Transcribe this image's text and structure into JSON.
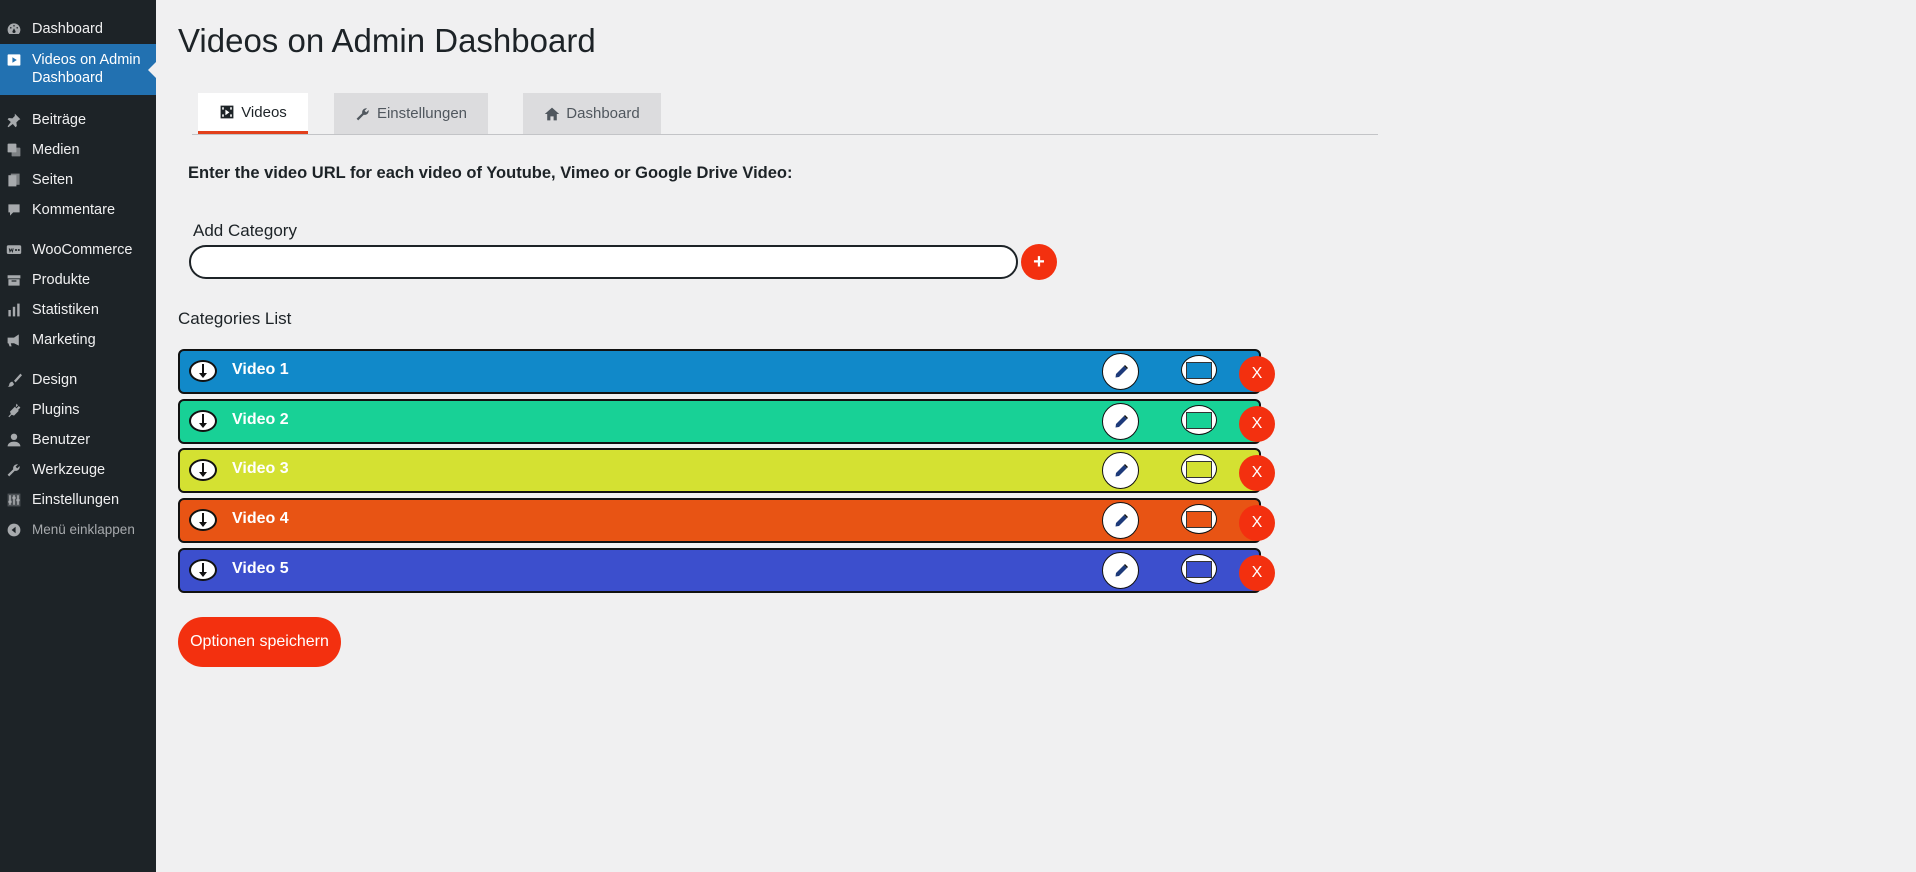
{
  "sidebar": {
    "items": [
      {
        "label": "Dashboard",
        "icon": "dashboard-icon"
      },
      {
        "label": "Videos on Admin Dashboard",
        "icon": "video-icon",
        "active": true
      },
      {
        "label": "Beiträge",
        "icon": "pin-icon"
      },
      {
        "label": "Medien",
        "icon": "media-icon"
      },
      {
        "label": "Seiten",
        "icon": "pages-icon"
      },
      {
        "label": "Kommentare",
        "icon": "comment-icon"
      },
      {
        "label": "WooCommerce",
        "icon": "woocommerce-icon"
      },
      {
        "label": "Produkte",
        "icon": "products-icon"
      },
      {
        "label": "Statistiken",
        "icon": "stats-icon"
      },
      {
        "label": "Marketing",
        "icon": "megaphone-icon"
      },
      {
        "label": "Design",
        "icon": "brush-icon"
      },
      {
        "label": "Plugins",
        "icon": "plugin-icon"
      },
      {
        "label": "Benutzer",
        "icon": "user-icon"
      },
      {
        "label": "Werkzeuge",
        "icon": "wrench-icon"
      },
      {
        "label": "Einstellungen",
        "icon": "settings-icon"
      },
      {
        "label": "Menü einklappen",
        "icon": "collapse-icon"
      }
    ]
  },
  "page": {
    "title": "Videos on Admin Dashboard"
  },
  "tabs": [
    {
      "label": "Videos",
      "icon": "film-icon",
      "active": true
    },
    {
      "label": "Einstellungen",
      "icon": "wrench-icon"
    },
    {
      "label": "Dashboard",
      "icon": "home-icon"
    }
  ],
  "instructions": "Enter the video URL for each video of Youtube, Vimeo or Google Drive Video:",
  "add_category": {
    "label": "Add Category",
    "value": "",
    "placeholder": "",
    "button": "+"
  },
  "categories_title": "Categories List",
  "categories": [
    {
      "name": "Video 1",
      "color": "#1189c9",
      "delete": "X"
    },
    {
      "name": "Video 2",
      "color": "#18d196",
      "delete": "X"
    },
    {
      "name": "Video 3",
      "color": "#d4e132",
      "delete": "X"
    },
    {
      "name": "Video 4",
      "color": "#e85414",
      "delete": "X"
    },
    {
      "name": "Video 5",
      "color": "#3c4fcd",
      "delete": "X"
    }
  ],
  "save_button": "Optionen speichern",
  "colors": {
    "accent": "#f3300f",
    "sidebar_bg": "#1d2327",
    "sidebar_active": "#2271b1"
  }
}
